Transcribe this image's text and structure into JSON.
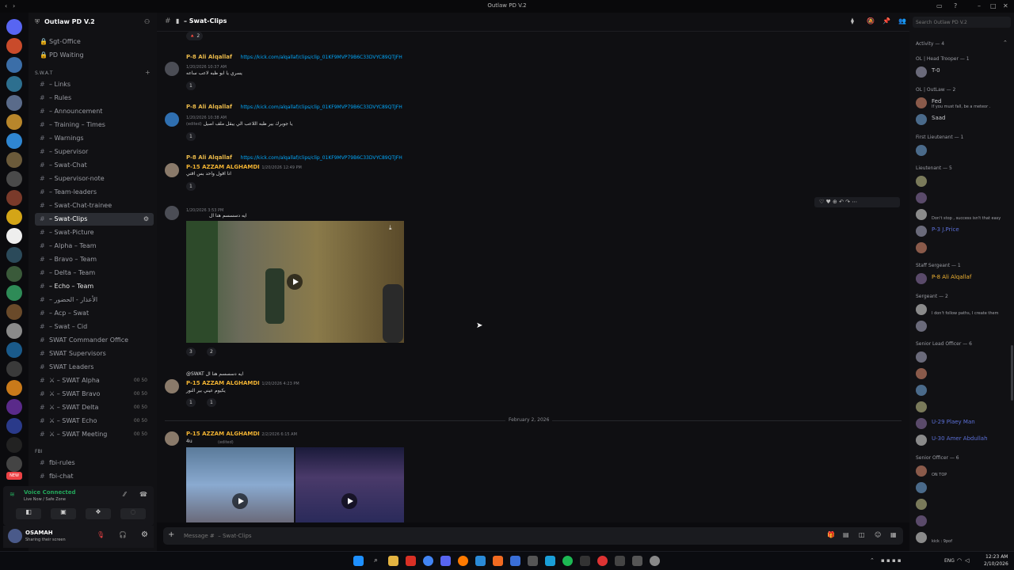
{
  "window": {
    "title": "Outlaw PD V.2"
  },
  "server": {
    "name": "Outlaw PD V.2"
  },
  "channels_top": [
    {
      "label": "Sgt-Office",
      "icon": "lock"
    },
    {
      "label": "PD Waiting",
      "icon": "lock"
    }
  ],
  "categories": {
    "swat": "S.W.A.T",
    "fbi": "FBI"
  },
  "channels": [
    {
      "label": "– Links"
    },
    {
      "label": "– Rules"
    },
    {
      "label": "– Announcement"
    },
    {
      "label": "– Training – Times"
    },
    {
      "label": "– Warnings"
    },
    {
      "label": "– Supervisor"
    },
    {
      "label": "– Swat-Chat"
    },
    {
      "label": "– Supervisor-note"
    },
    {
      "label": "– Team-leaders"
    },
    {
      "label": "– Swat-Chat-trainee"
    },
    {
      "label": "– Swat-Clips"
    },
    {
      "label": "– Swat-Picture"
    },
    {
      "label": "– Alpha – Team"
    },
    {
      "label": "– Bravo – Team"
    },
    {
      "label": "– Delta – Team"
    },
    {
      "label": "– Echo – Team"
    },
    {
      "label": "– الأعذار - الحضور"
    },
    {
      "label": "– Acp – Swat"
    },
    {
      "label": "– Swat – Cid"
    },
    {
      "label": "SWAT Commander Office"
    },
    {
      "label": "SWAT Supervisors"
    },
    {
      "label": "SWAT Leaders"
    },
    {
      "label": "⚔ – SWAT Alpha",
      "badge": "00 50"
    },
    {
      "label": "⚔ – SWAT Bravo",
      "badge": "00 50"
    },
    {
      "label": "⚔ – SWAT Delta",
      "badge": "00 50"
    },
    {
      "label": "⚔ – SWAT Echo",
      "badge": "00 50"
    },
    {
      "label": "⚔ – SWAT Meeting",
      "badge": "00 50"
    }
  ],
  "fbi_channels": [
    {
      "label": "fbi-rules"
    },
    {
      "label": "fbi-chat"
    }
  ],
  "voice": {
    "status": "Voice Connected",
    "location": "Live Now / Safe Zone"
  },
  "user": {
    "name": "OSAMAH",
    "status": "Sharing their screen"
  },
  "topbar": {
    "channel": "– Swat-Clips"
  },
  "messages": [
    {
      "reply_author": "P-8 Ali Alqallaf",
      "reply_link": "https://kick.com/alqallaf/clips/clip_01KF9MVP79B6C33DVYC89QTJFH",
      "author": "",
      "time": "1/20/2026 10:37 AM",
      "text": "يسري يا ابو ظبه لاعب ساعه",
      "reactions": [
        "1"
      ]
    },
    {
      "reply_author": "P-8 Ali Alqallaf",
      "reply_link": "https://kick.com/alqallaf/clips/clip_01KF9MVP79B6C33DVYC89QTJFH",
      "author": "",
      "time": "1/20/2026 10:38 AM",
      "text": "يا جوبرك بير ظبه اللاعب الي يبقل ملف اصيل",
      "edited": "(edited)",
      "reactions": [
        "1"
      ]
    },
    {
      "reply_author": "P-8 Ali Alqallaf",
      "reply_link": "https://kick.com/alqallaf/clips/clip_01KF9MVP79B6C33DVYC89QTJFH",
      "author": "P-15 AZZAM ALGHAMDI",
      "time": "1/20/2026 12:49 PM",
      "text": "انا اقول واحد بس اقتي",
      "reactions": [
        "1"
      ]
    },
    {
      "author": "",
      "time": "1/20/2026 3:53 PM",
      "text": "ايه دسسسم هنا ال",
      "reactions": [
        "3",
        "2"
      ]
    },
    {
      "reply_text": "@SWAT ايه دسسسم هنا ال",
      "author": "P-15 AZZAM ALGHAMDI",
      "time": "1/20/2026 4:23 PM",
      "text": "يكيوم عيني بير النور",
      "reactions": [
        "1",
        "1"
      ]
    }
  ],
  "date_divider": "February 2, 2026",
  "last_message": {
    "author": "P-15 AZZAM ALGHAMDI",
    "time": "2/2/2026 6:15 AM",
    "text": "4u",
    "edited": "(edited)"
  },
  "composer": {
    "placeholder": "Message #  – Swat-Clips"
  },
  "search": {
    "placeholder": "Search Outlaw PD V.2"
  },
  "members": {
    "activity": "Activity — 4",
    "groups": [
      {
        "title": "OL | Head Trooper — 1",
        "members": [
          {
            "name": "T-0",
            "status": ""
          }
        ]
      },
      {
        "title": "OL | OutLaw — 2",
        "members": [
          {
            "name": "Fed",
            "status": "If you must fall, be a meteor ."
          },
          {
            "name": "Saad",
            "status": ""
          }
        ]
      },
      {
        "title": "First Lieutenant — 1",
        "members": [
          {
            "name": "",
            "status": ""
          }
        ]
      },
      {
        "title": "Lieutenant — 5",
        "members": [
          {
            "name": "",
            "status": ""
          },
          {
            "name": "",
            "status": ""
          },
          {
            "name": "",
            "status": "Don't stop , success isn't that easy"
          },
          {
            "name": "P-3 J.Price",
            "status": ""
          },
          {
            "name": "",
            "status": ""
          }
        ]
      },
      {
        "title": "Staff Sergeant — 1",
        "members": [
          {
            "name": "P-8 Ali Alqallaf",
            "status": ""
          }
        ]
      },
      {
        "title": "Sergeant — 2",
        "members": [
          {
            "name": "",
            "status": "I don't follow paths, I create them"
          },
          {
            "name": "",
            "status": ""
          }
        ]
      },
      {
        "title": "Senior Lead Officer — 6",
        "members": [
          {
            "name": "",
            "status": ""
          },
          {
            "name": "",
            "status": ""
          },
          {
            "name": "",
            "status": ""
          },
          {
            "name": "",
            "status": ""
          },
          {
            "name": "U-29 Plaey Man",
            "status": ""
          },
          {
            "name": "U-30 Amer Abdullah",
            "status": ""
          }
        ]
      },
      {
        "title": "Senior Officer — 6",
        "members": [
          {
            "name": "",
            "status": "ON TOP"
          },
          {
            "name": "",
            "status": ""
          },
          {
            "name": "",
            "status": ""
          },
          {
            "name": "",
            "status": ""
          },
          {
            "name": "",
            "status": "kick : 9pof"
          }
        ]
      }
    ]
  },
  "taskbar": {
    "time": "12:23 AM",
    "date": "2/10/2026",
    "lang": "ENG"
  }
}
